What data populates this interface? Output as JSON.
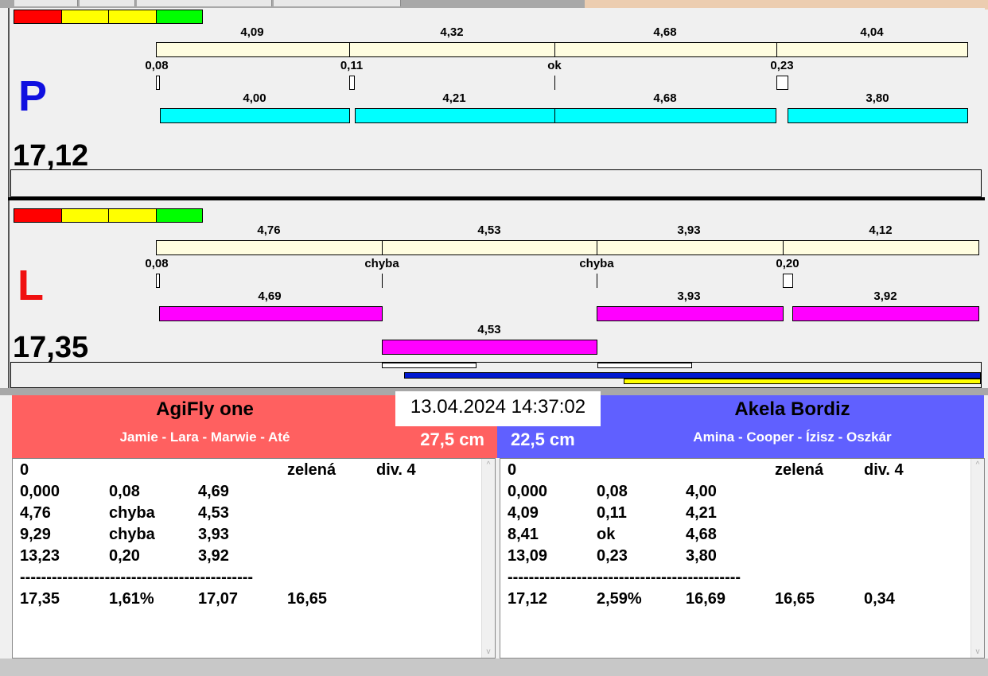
{
  "colors": {
    "red": "#ff0000",
    "yellow": "#ffff00",
    "green": "#00ff00",
    "cream": "#fffde0",
    "cyan": "#00ffff",
    "magenta": "#ff00ff",
    "team_left": "#ff6060",
    "team_right": "#6060ff"
  },
  "p": {
    "letter": "P",
    "total": "17,12",
    "seg_labels": [
      "4,09",
      "4,32",
      "4,68",
      "4,04"
    ],
    "small_labels": [
      "0,08",
      "0,11",
      "ok",
      "0,23"
    ],
    "bar_labels": [
      "4,00",
      "4,21",
      "4,68",
      "3,80"
    ]
  },
  "l": {
    "letter": "L",
    "total": "17,35",
    "seg_labels": [
      "4,76",
      "4,53",
      "3,93",
      "4,12"
    ],
    "small_labels": [
      "0,08",
      "chyba",
      "chyba",
      "0,20"
    ],
    "bar_labels": [
      "4,69",
      "3,93",
      "3,92",
      "4,53"
    ]
  },
  "datetime": "13.04.2024 14:37:02",
  "left": {
    "team": "AgiFly one",
    "members": "Jamie - Lara - Marwie - Até",
    "height": "27,5 cm",
    "rows": [
      [
        "0",
        "",
        "",
        "zelená",
        "div. 4"
      ],
      [
        "0,000",
        "0,08",
        "4,69",
        "",
        ""
      ],
      [
        "4,76",
        "chyba",
        "4,53",
        "",
        ""
      ],
      [
        "9,29",
        "chyba",
        "3,93",
        "",
        ""
      ],
      [
        "13,23",
        "0,20",
        "3,92",
        "",
        ""
      ],
      [
        "--------------------------------------------",
        "",
        "",
        "",
        ""
      ],
      [
        "17,35",
        "1,61%",
        "17,07",
        "16,65",
        ""
      ]
    ]
  },
  "right": {
    "team": "Akela Bordiz",
    "members": "Amina - Cooper - Ízisz - Oszkár",
    "height": "22,5 cm",
    "rows": [
      [
        "0",
        "",
        "",
        "zelená",
        "div. 4"
      ],
      [
        "0,000",
        "0,08",
        "4,00",
        "",
        ""
      ],
      [
        "4,09",
        "0,11",
        "4,21",
        "",
        ""
      ],
      [
        "8,41",
        "ok",
        "4,68",
        "",
        ""
      ],
      [
        "13,09",
        "0,23",
        "3,80",
        "",
        ""
      ],
      [
        "--------------------------------------------",
        "",
        "",
        "",
        ""
      ],
      [
        "17,12",
        "2,59%",
        "16,69",
        "16,65",
        "0,34"
      ]
    ]
  }
}
